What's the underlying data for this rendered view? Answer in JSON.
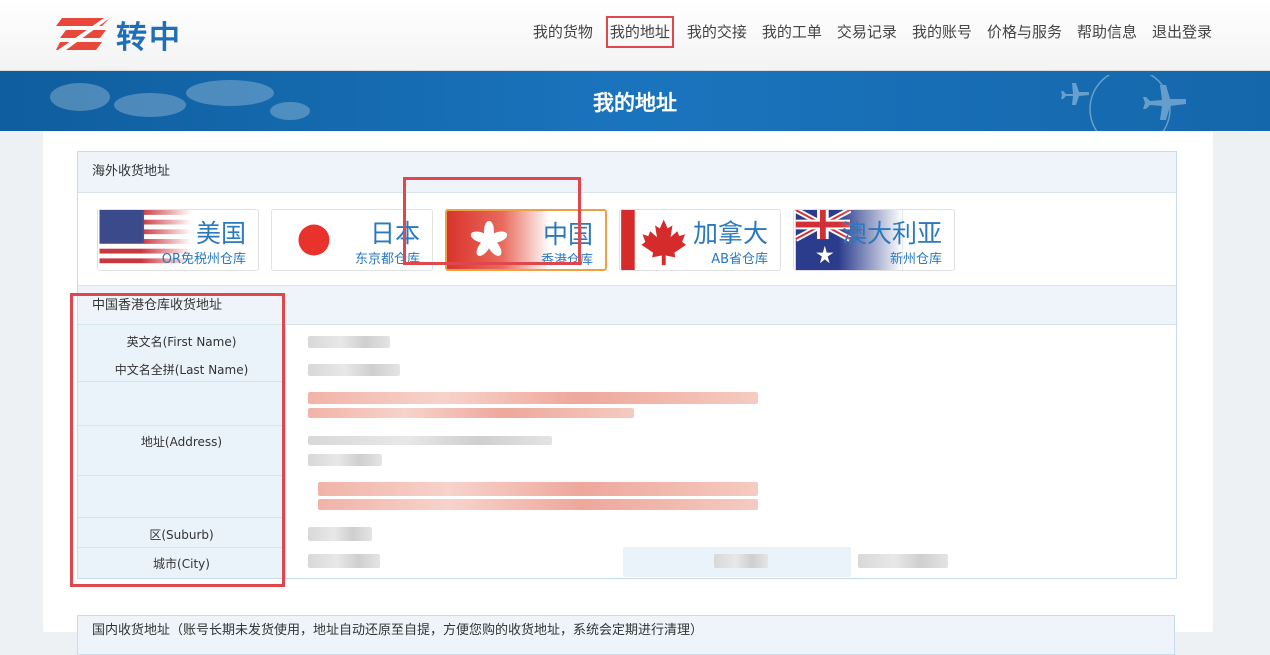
{
  "brand": {
    "name": "转中"
  },
  "nav": [
    {
      "label": "我的货物",
      "active": false
    },
    {
      "label": "我的地址",
      "active": true
    },
    {
      "label": "我的交接",
      "active": false
    },
    {
      "label": "我的工单",
      "active": false
    },
    {
      "label": "交易记录",
      "active": false
    },
    {
      "label": "我的账号",
      "active": false
    },
    {
      "label": "价格与服务",
      "active": false
    },
    {
      "label": "帮助信息",
      "active": false
    },
    {
      "label": "退出登录",
      "active": false
    }
  ],
  "banner": {
    "title": "我的地址"
  },
  "overseas": {
    "title": "海外收货地址"
  },
  "warehouses": [
    {
      "country": "美国",
      "warehouse": "OR免税州仓库",
      "flag": "us-flag-icon"
    },
    {
      "country": "日本",
      "warehouse": "东京都仓库",
      "flag": "jp-flag-icon"
    },
    {
      "country": "中国",
      "warehouse": "香港仓库",
      "flag": "hk-flag-icon",
      "active": true
    },
    {
      "country": "加拿大",
      "warehouse": "AB省仓库",
      "flag": "ca-flag-icon"
    },
    {
      "country": "澳大利亚",
      "warehouse": "新州仓库",
      "flag": "au-flag-icon"
    }
  ],
  "address": {
    "title": "中国香港仓库收货地址",
    "labels": {
      "first_name": "英文名(First Name)",
      "last_name": "中文名全拼(Last Name)",
      "address": "地址(Address)",
      "suburb": "区(Suburb)",
      "city": "城市(City)"
    }
  },
  "domestic": {
    "title": "国内收货地址（账号长期未发货使用，地址自动还原至自提，方便您购的收货地址，系统会定期进行清理）"
  },
  "colors": {
    "accent": "#1f6fb8",
    "highlight": "#e0474c",
    "active_tab_border": "#f0a044"
  }
}
